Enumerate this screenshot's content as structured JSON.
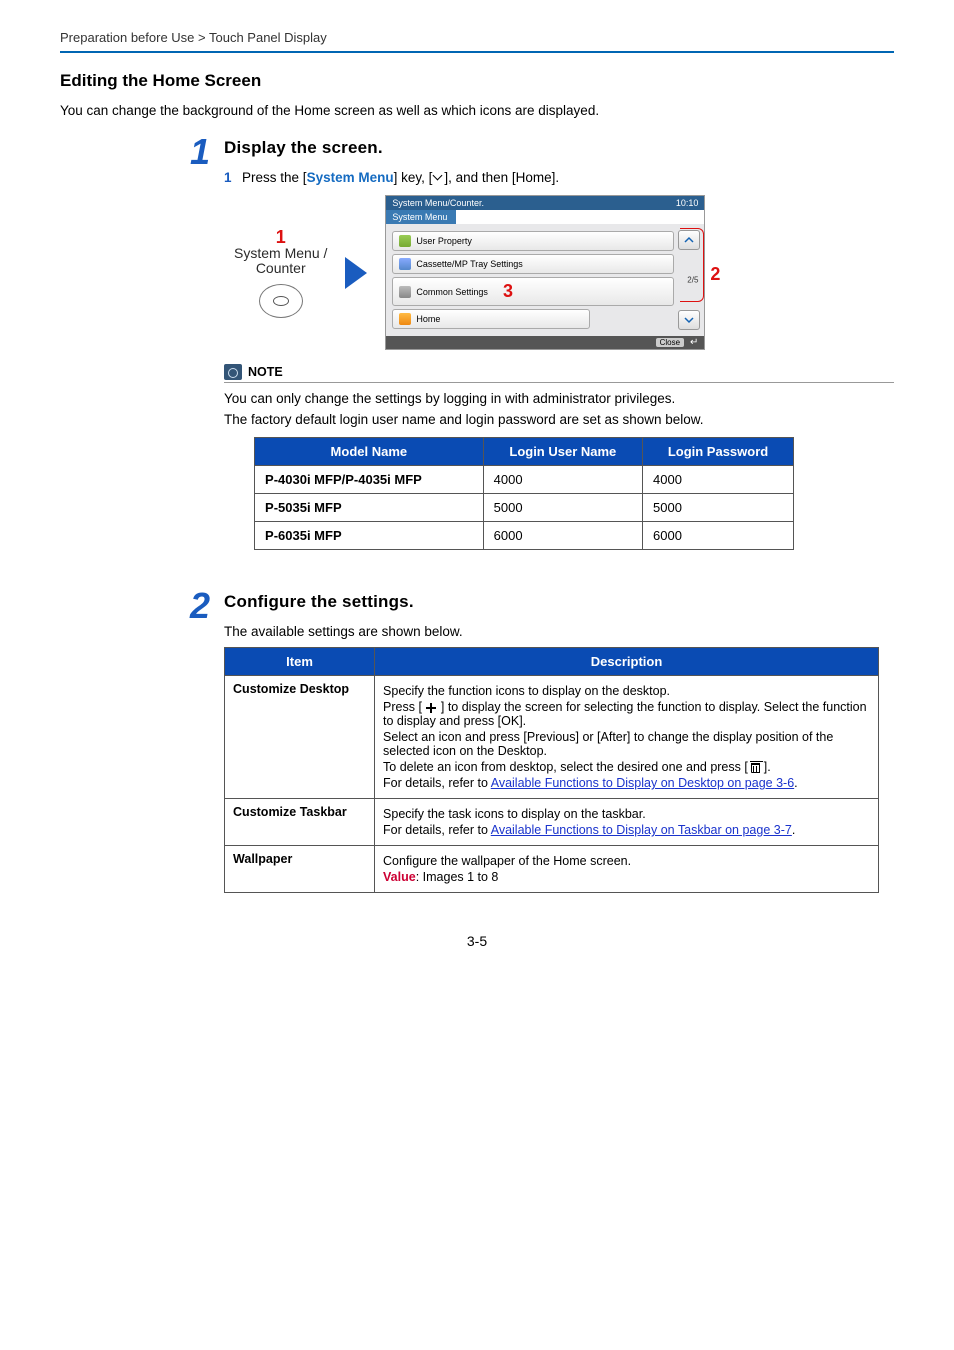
{
  "breadcrumb": "Preparation before Use > Touch Panel Display",
  "heading": "Editing the Home Screen",
  "intro": "You can change the background of the Home screen as well as which icons are displayed.",
  "step1": {
    "num": "1",
    "title": "Display the screen.",
    "substep_num": "1",
    "substep_a": "Press the [",
    "system_menu": "System Menu",
    "substep_b": "] key, [",
    "substep_c": "], and then [Home].",
    "callout1": "1",
    "callout2": "2",
    "callout3": "3",
    "panel_label_1": "System Menu /",
    "panel_label_2": "Counter",
    "screen": {
      "title": "System Menu/Counter.",
      "time": "10:10",
      "tab": "System Menu",
      "row1": "User Property",
      "row2": "Cassette/MP Tray Settings",
      "row3": "Common Settings",
      "row4": "Home",
      "pager": "2/5",
      "close": "Close"
    }
  },
  "note": {
    "label": "NOTE",
    "p1": "You can only change the settings by logging in with administrator privileges.",
    "p2": "The factory default login user name and login password are set as shown below."
  },
  "cred_table": {
    "h1": "Model Name",
    "h2": "Login User Name",
    "h3": "Login Password",
    "rows": [
      {
        "model": "P-4030i MFP/P-4035i MFP",
        "user": "4000",
        "pass": "4000"
      },
      {
        "model": "P-5035i MFP",
        "user": "5000",
        "pass": "5000"
      },
      {
        "model": "P-6035i MFP",
        "user": "6000",
        "pass": "6000"
      }
    ]
  },
  "step2": {
    "num": "2",
    "title": "Configure the settings.",
    "intro": "The available settings are shown below."
  },
  "settings_table": {
    "h1": "Item",
    "h2": "Description",
    "r1": {
      "item": "Customize Desktop",
      "p1": "Specify the function icons to display on the desktop.",
      "p2a": "Press [ ",
      "p2b": " ] to display the screen for selecting the function to display. Select the function to display and press [OK].",
      "p3": "Select an icon and press [Previous] or [After] to change the display position of the selected icon on the Desktop.",
      "p4a": "To delete an icon from desktop, select the desired one and press [ ",
      "p4b": " ].",
      "p5a": "For details, refer to ",
      "p5link": "Available Functions to Display on Desktop on page 3-6",
      "p5b": "."
    },
    "r2": {
      "item": "Customize Taskbar",
      "p1": "Specify the task icons to display on the taskbar.",
      "p2a": "For details, refer to ",
      "p2link": "Available Functions to Display on Taskbar on page 3-7",
      "p2b": "."
    },
    "r3": {
      "item": "Wallpaper",
      "p1": "Configure the wallpaper of the Home screen.",
      "vlabel": "Value",
      "vtext": ": Images 1 to 8"
    }
  },
  "page_num": "3-5"
}
